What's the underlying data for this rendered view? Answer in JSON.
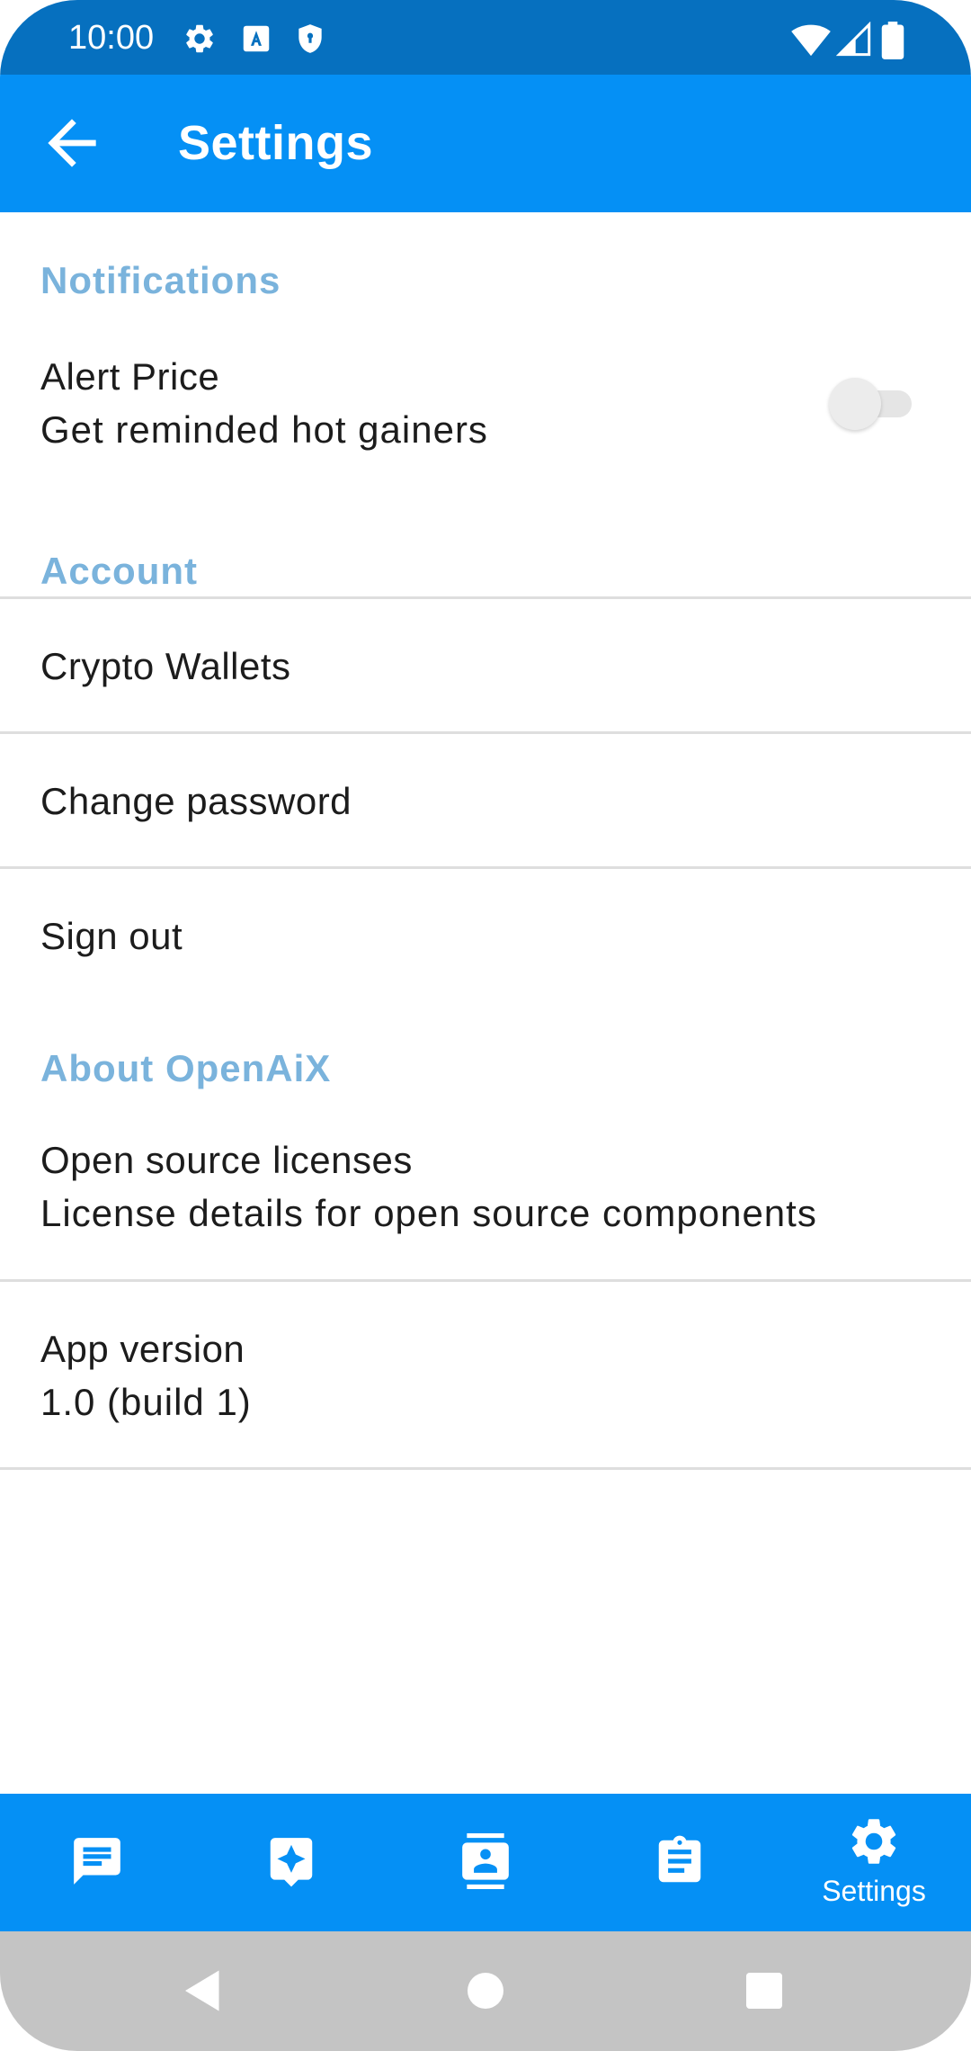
{
  "status_bar": {
    "time": "10:00",
    "icons": [
      "gear-icon",
      "font-a-icon",
      "shield-icon",
      "wifi-icon",
      "signal-icon",
      "battery-icon"
    ]
  },
  "app_bar": {
    "title": "Settings",
    "back_icon": "arrow-left-icon"
  },
  "sections": {
    "notifications": {
      "header": "Notifications",
      "alert_price": {
        "title": "Alert Price",
        "summary": "Get reminded hot gainers",
        "enabled": false
      }
    },
    "account": {
      "header": "Account",
      "items": [
        "Crypto Wallets",
        "Change password",
        "Sign out"
      ]
    },
    "about": {
      "header": "About OpenAiX",
      "licenses": {
        "title": "Open source licenses",
        "summary": "License details for open source components"
      },
      "version": {
        "title": "App version",
        "summary": "1.0 (build 1)"
      }
    }
  },
  "bottom_nav": {
    "items": [
      {
        "icon": "chat-icon",
        "label": ""
      },
      {
        "icon": "sparkle-message-icon",
        "label": ""
      },
      {
        "icon": "contact-card-icon",
        "label": ""
      },
      {
        "icon": "clipboard-icon",
        "label": ""
      },
      {
        "icon": "gear-icon",
        "label": "Settings"
      }
    ],
    "active_index": 4
  },
  "colors": {
    "status_bar": "#0670bf",
    "app_bar": "#0590f5",
    "section_header": "#7ab3dc",
    "system_nav": "#c4c4c4"
  }
}
